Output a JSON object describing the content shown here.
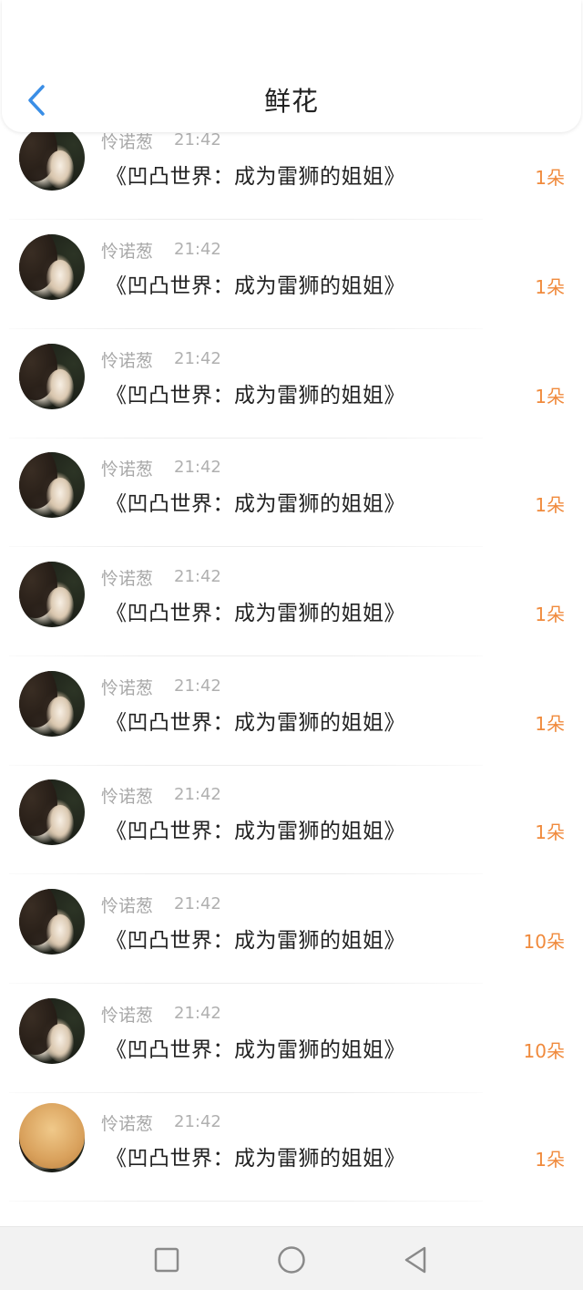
{
  "header": {
    "title": "鲜花",
    "back_icon": "chevron-left-icon",
    "accent_color": "#3a8ee6"
  },
  "items": [
    {
      "user": "怜诺葱",
      "time": "21:42",
      "book": "《凹凸世界：成为雷狮的姐姐》",
      "amount": "1朵"
    },
    {
      "user": "怜诺葱",
      "time": "21:42",
      "book": "《凹凸世界：成为雷狮的姐姐》",
      "amount": "1朵"
    },
    {
      "user": "怜诺葱",
      "time": "21:42",
      "book": "《凹凸世界：成为雷狮的姐姐》",
      "amount": "1朵"
    },
    {
      "user": "怜诺葱",
      "time": "21:42",
      "book": "《凹凸世界：成为雷狮的姐姐》",
      "amount": "1朵"
    },
    {
      "user": "怜诺葱",
      "time": "21:42",
      "book": "《凹凸世界：成为雷狮的姐姐》",
      "amount": "1朵"
    },
    {
      "user": "怜诺葱",
      "time": "21:42",
      "book": "《凹凸世界：成为雷狮的姐姐》",
      "amount": "1朵"
    },
    {
      "user": "怜诺葱",
      "time": "21:42",
      "book": "《凹凸世界：成为雷狮的姐姐》",
      "amount": "1朵"
    },
    {
      "user": "怜诺葱",
      "time": "21:42",
      "book": "《凹凸世界：成为雷狮的姐姐》",
      "amount": "10朵"
    },
    {
      "user": "怜诺葱",
      "time": "21:42",
      "book": "《凹凸世界：成为雷狮的姐姐》",
      "amount": "10朵"
    },
    {
      "user": "怜诺葱",
      "time": "21:42",
      "book": "《凹凸世界：成为雷狮的姐姐》",
      "amount": "1朵"
    }
  ],
  "amount_color": "#f08a3c",
  "navbar": {
    "icons": [
      "square-recent-apps-icon",
      "circle-home-icon",
      "triangle-back-icon"
    ]
  }
}
